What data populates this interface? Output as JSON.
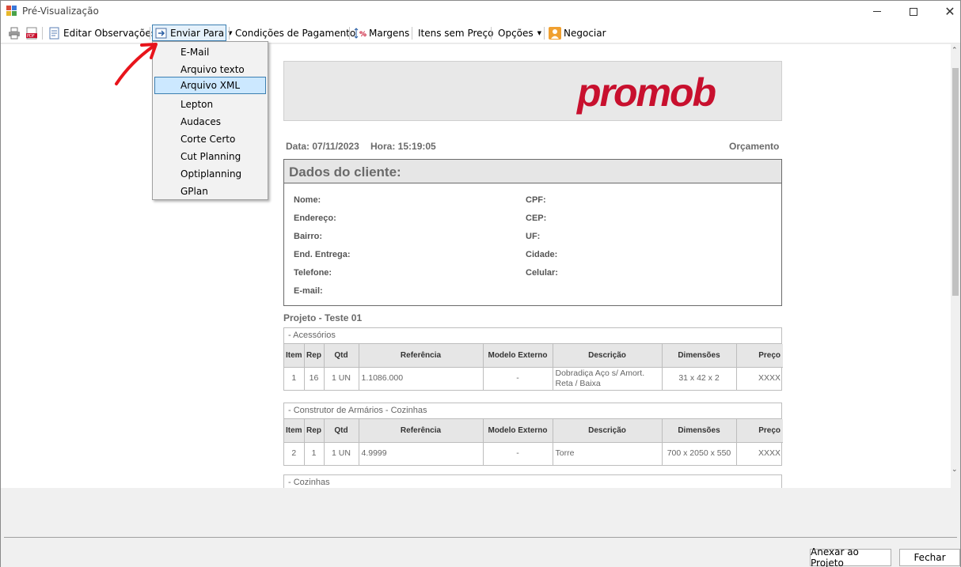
{
  "window": {
    "title": "Pré-Visualização"
  },
  "toolbar": {
    "edit_notes": "Editar Observações",
    "send_to": "Enviar Para",
    "payment_terms": "Condições de Pagamento",
    "margins": "Margens",
    "items_no_price": "Itens sem Preço",
    "options": "Opções",
    "negotiate": "Negociar"
  },
  "send_menu": {
    "items": [
      "E-Mail",
      "Arquivo texto",
      "Arquivo XML",
      "Lepton",
      "Audaces",
      "Corte Certo",
      "Cut Planning",
      "Optiplanning",
      "GPlan"
    ],
    "selected": "Arquivo XML"
  },
  "document": {
    "logo": "promob",
    "date": "Data: 07/11/2023",
    "time": "Hora: 15:19:05",
    "doc_type": "Orçamento",
    "client": {
      "header": "Dados do cliente:",
      "labels_left": [
        "Nome:",
        "Endereço:",
        "Bairro:",
        "End. Entrega:",
        "Telefone:",
        "E-mail:"
      ],
      "labels_right": [
        "CPF:",
        "CEP:",
        "UF:",
        "Cidade:",
        "Celular:"
      ]
    },
    "project": "Projeto - Teste 01",
    "columns": [
      "Item",
      "Rep",
      "Qtd",
      "Referência",
      "Modelo Externo",
      "Descrição",
      "Dimensões",
      "Preço"
    ],
    "sections": [
      {
        "title": "- Acessórios",
        "rows": [
          {
            "item": "1",
            "rep": "16",
            "qtd": "1 UN",
            "ref": "1.1086.000",
            "model": "-",
            "desc": "Dobradiça Aço s/ Amort. Reta / Baixa",
            "dims": "31 x 42 x 2",
            "price": "XXXX"
          }
        ]
      },
      {
        "title": "- Construtor de Armários - Cozinhas",
        "rows": [
          {
            "item": "2",
            "rep": "1",
            "qtd": "1 UN",
            "ref": "4.9999",
            "model": "-",
            "desc": "Torre",
            "dims": "700 x 2050 x 550",
            "price": "XXXX"
          }
        ]
      },
      {
        "title": "- Cozinhas",
        "rows": []
      }
    ]
  },
  "footer": {
    "attach": "Anexar ao Projeto",
    "close": "Fechar"
  },
  "colors": {
    "logo_red": "#c8102e",
    "annotation_arrow": "#e8141b",
    "menu_highlight": "#cce8ff"
  }
}
